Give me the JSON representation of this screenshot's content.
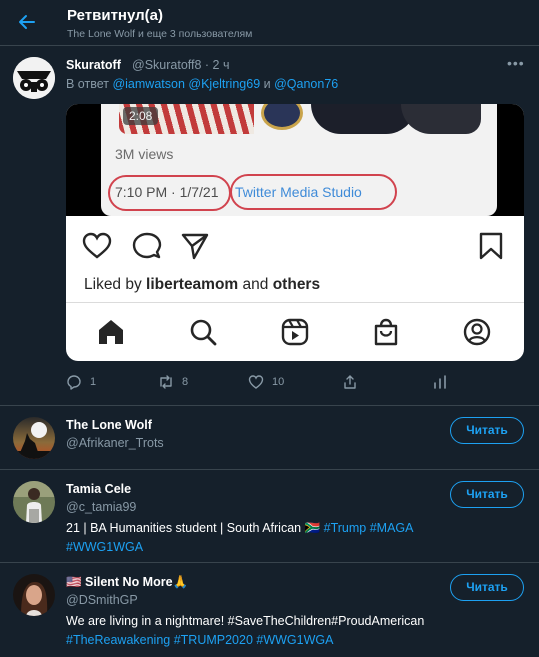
{
  "header": {
    "title": "Ретвитнул(а)",
    "subtitle": "The Lone Wolf и еще 3 пользователям"
  },
  "tweet": {
    "name": "Skuratoff",
    "handle_time": "@Skuratoff8 · 2 ч",
    "reply_prefix": "В ответ",
    "reply_user1": "@iamwatson",
    "reply_user2": "@Kjeltring69",
    "reply_and": "и",
    "reply_user3": "@Qanon76",
    "media": {
      "duration": "2:08",
      "views": "3M views",
      "timestamp": "7:10 PM · 1/7/21",
      "studio": "Twitter Media Studio",
      "liked_prefix": "Liked by",
      "liked_user": "liberteamom",
      "liked_and": "and",
      "liked_others": "others"
    },
    "actions": {
      "replies": "1",
      "retweets": "8",
      "likes": "10"
    }
  },
  "users": [
    {
      "name": "The Lone Wolf",
      "handle": "@Afrikaner_Trots",
      "bio_text": "",
      "bio_tags": "",
      "follow_label": "Читать"
    },
    {
      "name": "Tamia Cele",
      "handle": "@c_tamia99",
      "bio_text": "21 | BA Humanities student | South African 🇿🇦",
      "bio_tags": "#Trump #MAGA",
      "bio_line2": "#WWG1WGA",
      "follow_label": "Читать"
    },
    {
      "name": "🇺🇸 Silent No More🙏",
      "handle": "@DSmithGP",
      "bio_text": "We are living in a nightmare! #SaveTheChildren#ProudAmerican",
      "bio_line2": "#TheReawakening #TRUMP2020 #WWG1WGA",
      "follow_label": "Читать"
    }
  ],
  "colors": {
    "background": "#15202b",
    "accent": "#1da1f2",
    "muted": "#8899a6",
    "divider": "#38444d",
    "highlight_circle": "#d1434e"
  }
}
